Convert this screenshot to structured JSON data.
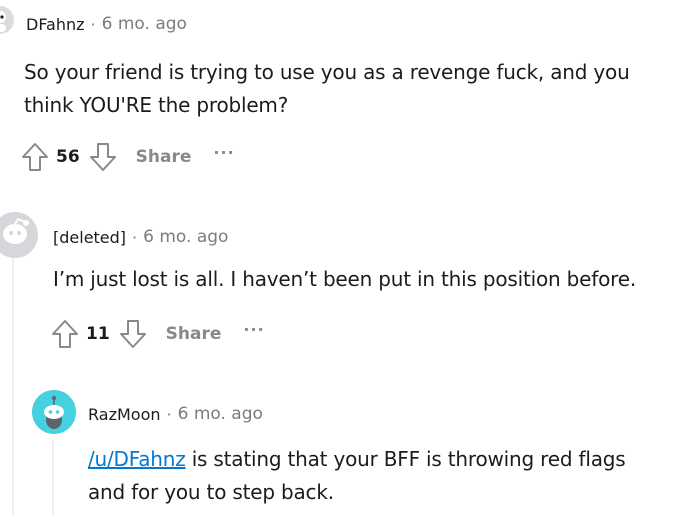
{
  "comments": [
    {
      "username": "DFahnz",
      "separator": "·",
      "time": "6 mo. ago",
      "body_line1": "So your friend is trying to use you as a revenge fuck, and you",
      "body_line2": "think YOU'RE the problem?",
      "votes": "56",
      "share_label": "Share",
      "more_label": "···",
      "avatar_icon": "user-avatar-partial-icon"
    },
    {
      "username": "[deleted]",
      "separator": "·",
      "time": "6 mo. ago",
      "body_line1": "I’m just lost is all. I haven’t been put in this position before.",
      "votes": "11",
      "share_label": "Share",
      "more_label": "···",
      "avatar_icon": "deleted-user-avatar-icon"
    },
    {
      "username": "RazMoon",
      "separator": "·",
      "time": "6 mo. ago",
      "link_text": "/u/DFahnz",
      "body_line1_rest": " is stating that your BFF is throwing red flags",
      "body_line2": "and for you to step back.",
      "avatar_icon": "snoo-avatar-icon"
    }
  ],
  "colors": {
    "link": "#0079d3",
    "meta_gray": "#7c7c7c",
    "action_gray": "#878a8c",
    "avatar_teal": "#46d1e0",
    "thread_line": "#edeff1"
  }
}
